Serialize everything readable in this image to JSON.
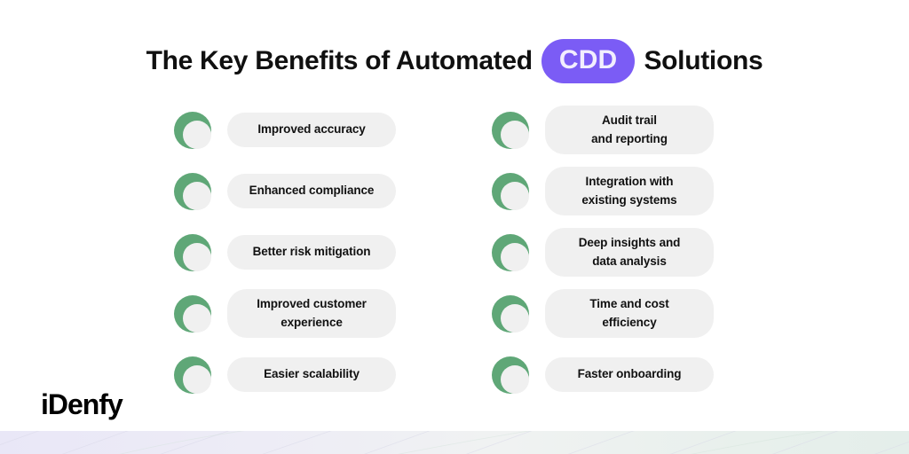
{
  "title": {
    "before": "The Key Benefits of Automated",
    "badge": "CDD",
    "after": "Solutions",
    "badge_color": "#7B5CF5",
    "text_color": "#101010"
  },
  "theme": {
    "background": "#FFFFFF",
    "pill_background": "#F0F0F0",
    "pill_text": "#111111",
    "icon_green": "#5FA777",
    "icon_inner": "#F0F0F0",
    "band_left": "#E9E7F7",
    "band_right": "#E4EEEA"
  },
  "icon_name": "green-crescent-check-icon",
  "columns": {
    "left": [
      {
        "label": "Improved accuracy",
        "lines": 1,
        "icon": "green-crescent-icon"
      },
      {
        "label": "Enhanced compliance",
        "lines": 1,
        "icon": "green-crescent-icon"
      },
      {
        "label": "Better risk mitigation",
        "lines": 1,
        "icon": "green-crescent-icon"
      },
      {
        "label": "Improved customer\nexperience",
        "lines": 2,
        "icon": "green-crescent-icon"
      },
      {
        "label": "Easier scalability",
        "lines": 1,
        "icon": "green-crescent-icon"
      }
    ],
    "right": [
      {
        "label": "Audit trail\nand reporting",
        "lines": 2,
        "icon": "green-crescent-icon"
      },
      {
        "label": "Integration with\nexisting systems",
        "lines": 2,
        "icon": "green-crescent-icon"
      },
      {
        "label": "Deep insights and\ndata analysis",
        "lines": 2,
        "icon": "green-crescent-icon"
      },
      {
        "label": "Time and cost\nefficiency",
        "lines": 2,
        "icon": "green-crescent-icon"
      },
      {
        "label": "Faster onboarding",
        "lines": 1,
        "icon": "green-crescent-icon"
      }
    ]
  },
  "logo": {
    "text": "iDenfy"
  }
}
